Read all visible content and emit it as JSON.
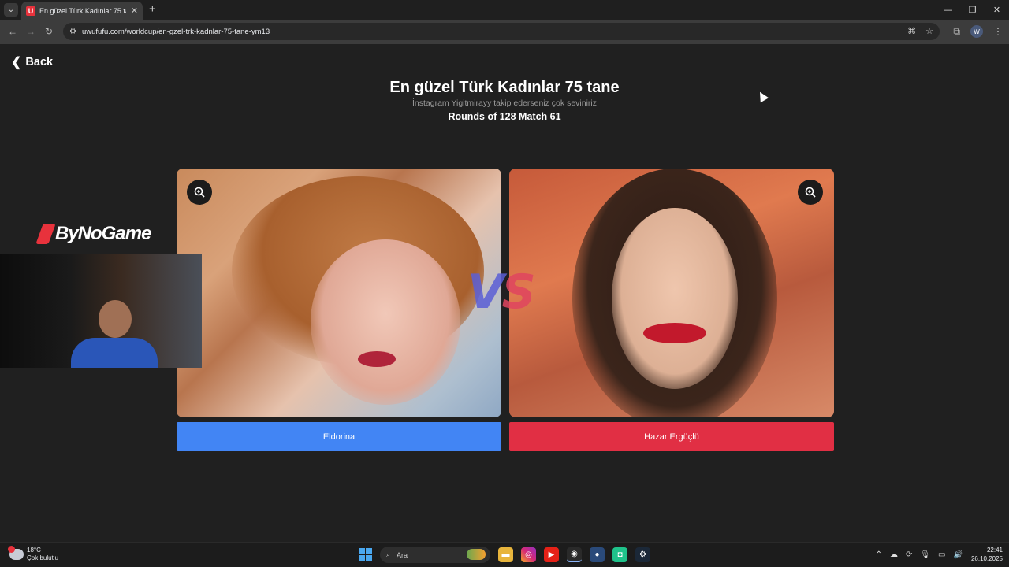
{
  "browser": {
    "tab_title": "En güzel Türk Kadınlar 75 tane |",
    "favicon_letter": "U",
    "url": "uwufufu.com/worldcup/en-gzel-trk-kadnlar-75-tane-ym13",
    "profile_initial": "W",
    "window_controls": [
      "—",
      "❐",
      "✕"
    ]
  },
  "page": {
    "back_label": "Back",
    "title": "En güzel Türk Kadınlar 75 tane",
    "subtitle": "İnstagram Yigitmirayy takip ederseniz çok seviniriz",
    "round_info": "Rounds of 128 Match 61",
    "vs_v": "V",
    "vs_s": "S",
    "left_choice": "Eldorina",
    "right_choice": "Hazar Ergüçlü",
    "colors": {
      "left": "#4285f4",
      "right": "#e12f44"
    }
  },
  "overlay": {
    "brand": "ByNoGame"
  },
  "taskbar": {
    "temperature": "18°C",
    "weather": "Çok bulutlu",
    "search_placeholder": "Ara",
    "time": "22:41",
    "date": "26.10.2025"
  }
}
